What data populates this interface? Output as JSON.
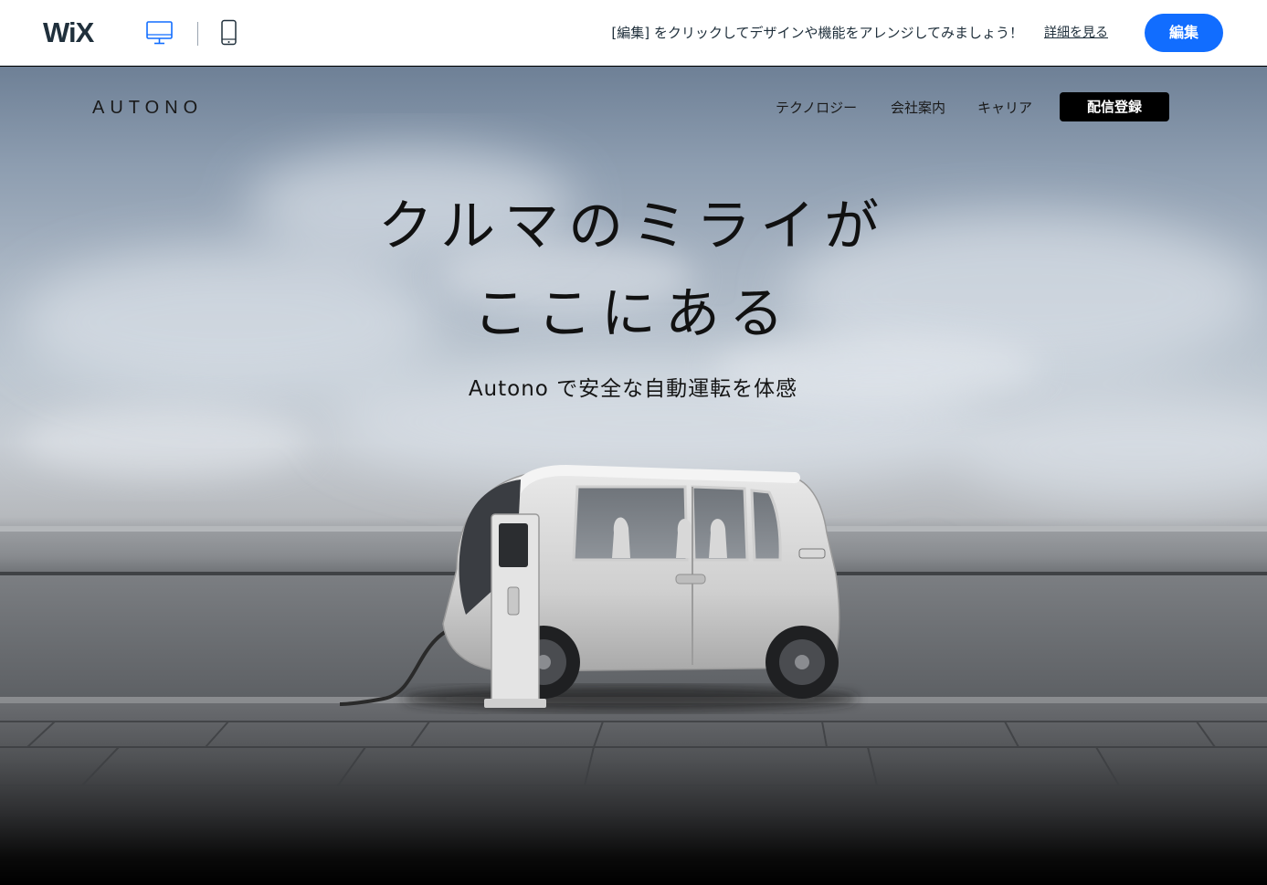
{
  "wix_bar": {
    "logo": "WiX",
    "view_desktop_icon": "desktop-icon",
    "view_mobile_icon": "mobile-icon",
    "message": "[編集] をクリックしてデザインや機能をアレンジしてみましょう！",
    "learn_more": "詳細を見る",
    "edit_button": "編集",
    "accent_color": "#116dff"
  },
  "site": {
    "logo": "AUTONO",
    "nav": [
      "テクノロジー",
      "会社案内",
      "キャリア"
    ],
    "subscribe_button": "配信登録"
  },
  "hero": {
    "headline_line1": "クルマのミライが",
    "headline_line2": "ここにある",
    "subheadline": "Autono で安全な自動運転を体感",
    "image": "white-electric-car-charging-icon"
  }
}
